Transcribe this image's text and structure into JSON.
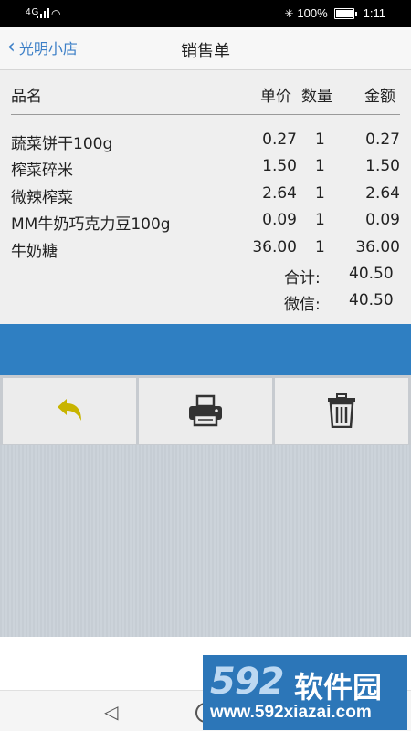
{
  "status": {
    "network": "4G",
    "bluetooth_icon": "bluetooth-icon",
    "battery_level": 100,
    "battery_text": "100%",
    "time": "1:11"
  },
  "nav": {
    "back_label": "光明小店",
    "title": "销售单"
  },
  "receipt": {
    "headers": {
      "name": "品名",
      "price": "单价",
      "qty": "数量",
      "amount": "金额"
    },
    "items": [
      {
        "name": "蔬菜饼干100g",
        "price": "0.27",
        "qty": "1",
        "amount": "0.27"
      },
      {
        "name": "榨菜碎米",
        "price": "1.50",
        "qty": "1",
        "amount": "1.50"
      },
      {
        "name": "微辣榨菜",
        "price": "2.64",
        "qty": "1",
        "amount": "2.64"
      },
      {
        "name": "MM牛奶巧克力豆100g",
        "price": "0.09",
        "qty": "1",
        "amount": "0.09"
      },
      {
        "name": "牛奶糖",
        "price": "36.00",
        "qty": "1",
        "amount": "36.00"
      }
    ],
    "total_label": "合计:",
    "total_value": "40.50",
    "payment_label": "微信:",
    "payment_value": "40.50"
  },
  "toolbar": {
    "buttons": [
      {
        "icon": "undo-icon",
        "color": "#c8b400"
      },
      {
        "icon": "printer-icon",
        "color": "#333333"
      },
      {
        "icon": "trash-icon",
        "color": "#333333"
      }
    ]
  },
  "colors": {
    "accent": "#2f7fc2",
    "link": "#3c7fc7",
    "undo": "#c8b400"
  },
  "watermark": {
    "brand_number": "592",
    "brand_text": "软件园",
    "url": "www.592xiazai.com"
  }
}
